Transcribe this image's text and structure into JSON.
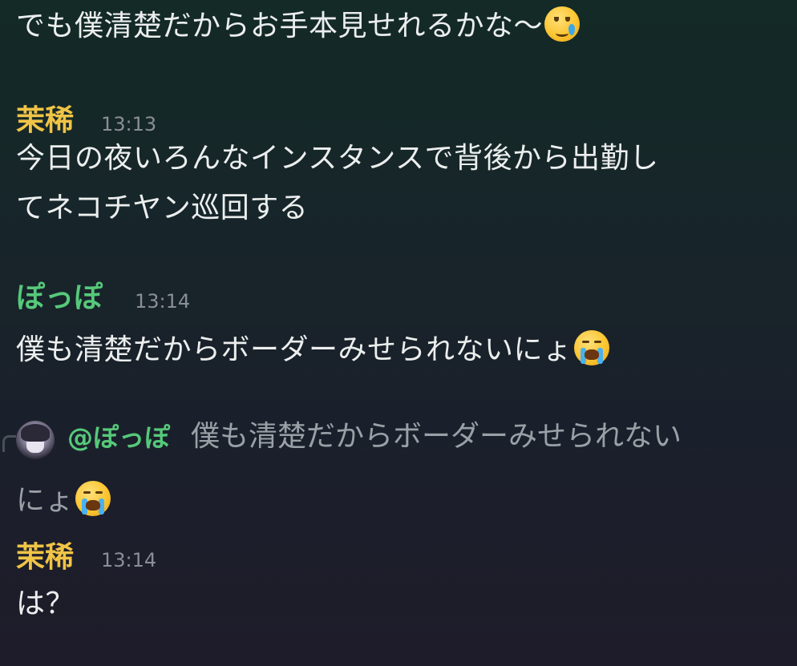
{
  "messages": [
    {
      "continuation_text": "でも僕清楚だからお手本見せれるかな〜",
      "emoji": "tear-smile-emoji"
    },
    {
      "author": "茉稀",
      "time": "13:13",
      "lines": [
        "今日の夜いろんなインスタンスで背後から出勤し",
        "てネコチヤン巡回する"
      ]
    },
    {
      "author": "ぽっぽ",
      "time": "13:14",
      "text": "僕も清楚だからボーダーみせられないにょ",
      "emoji": "loudly-crying-emoji"
    },
    {
      "reply_preview": {
        "mention": "@ぽっぽ",
        "line1": "僕も清楚だからボーダーみせられない",
        "line2": "にょ",
        "emoji": "loudly-crying-emoji"
      },
      "author": "茉稀",
      "time": "13:14",
      "text": "は？"
    }
  ],
  "colors": {
    "author_mari": "#f0c446",
    "author_poppo": "#56c97a",
    "timestamp": "#8a8e96",
    "text": "#eceeee",
    "reply_text": "#9aa0a6"
  }
}
